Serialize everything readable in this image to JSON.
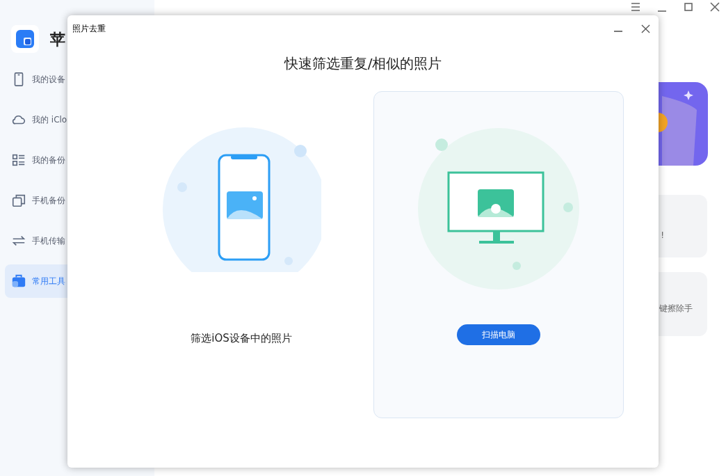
{
  "app": {
    "logo_text": "苹",
    "sidebar": [
      {
        "label": "我的设备",
        "kind": "phone",
        "selected": false
      },
      {
        "label": "我的 iClo",
        "kind": "cloud",
        "selected": false
      },
      {
        "label": "我的备份",
        "kind": "list",
        "selected": false
      },
      {
        "label": "手机备份",
        "kind": "copy",
        "selected": false
      },
      {
        "label": "手机传输",
        "kind": "swap",
        "selected": false
      },
      {
        "label": "常用工具",
        "kind": "toolbox",
        "selected": true
      }
    ],
    "cards": [
      {
        "text": "!"
      },
      {
        "text": "键擦除手"
      }
    ]
  },
  "dialog": {
    "title": "照片去重",
    "heading": "快速筛选重复/相似的照片",
    "options": [
      {
        "kind": "phone",
        "label": "筛选iOS设备中的照片",
        "selected": false
      },
      {
        "kind": "computer",
        "button": "扫描电脑",
        "selected": true
      }
    ]
  }
}
